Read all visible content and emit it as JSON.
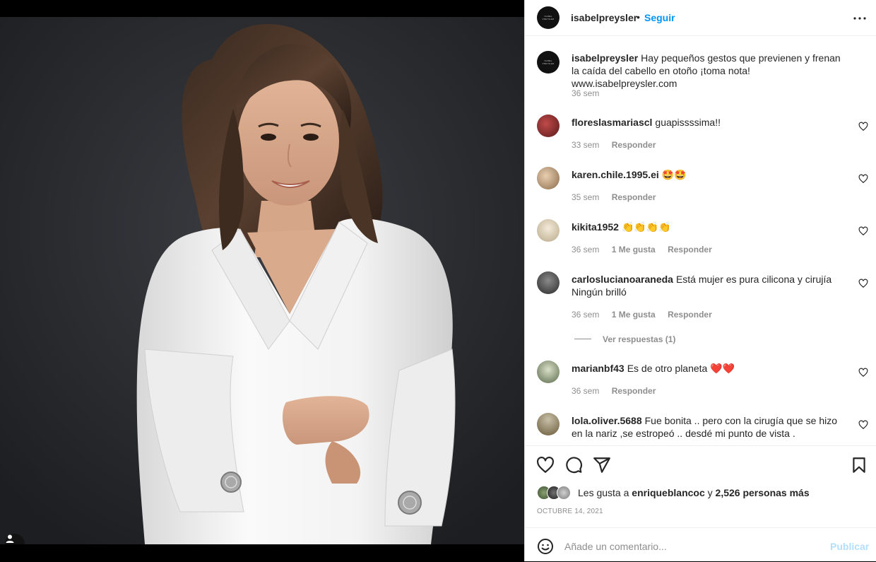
{
  "post": {
    "author": "isabelpreysler",
    "follow_label": "Seguir",
    "dot": "•",
    "caption": "Hay pequeños gestos que previenen y frenan la caída del cabello en otoño ¡toma nota! www.isabelpreysler.com",
    "caption_time": "36 sem",
    "logo_text": "ISABEL PREYSLER"
  },
  "comments": [
    {
      "user": "floreslasmariascl",
      "text": "guapissssima!!",
      "time": "33 sem",
      "likes": "",
      "reply": "Responder",
      "avatar_color": "#7a2a2a"
    },
    {
      "user": "karen.chile.1995.ei",
      "text": "🤩🤩",
      "time": "35 sem",
      "likes": "",
      "reply": "Responder",
      "avatar_color": "#c9a87f"
    },
    {
      "user": "kikita1952",
      "text": "👏👏👏👏",
      "time": "36 sem",
      "likes": "1 Me gusta",
      "reply": "Responder",
      "avatar_color": "#d8c9a8"
    },
    {
      "user": "carloslucianoaraneda",
      "text": "Está mujer es pura cilicona y cirujía Ningún brilló",
      "time": "36 sem",
      "likes": "1 Me gusta",
      "reply": "Responder",
      "avatar_color": "#4a4a4a",
      "view_replies": "Ver respuestas (1)"
    },
    {
      "user": "marianbf43",
      "text": "Es de otro planeta ❤️❤️",
      "time": "36 sem",
      "likes": "",
      "reply": "Responder",
      "avatar_color": "#8a9a7a"
    },
    {
      "user": "lola.oliver.5688",
      "text": "Fue bonita .. pero con la cirugía que se hizo en la nariz ,se estropeó .. desdé mi punto de vista .",
      "time": "",
      "likes": "",
      "reply": "",
      "avatar_color": "#9a8a6a"
    }
  ],
  "likes": {
    "prefix": "Les gusta a",
    "user": "enriqueblancoc",
    "conj": "y",
    "count": "2,526 personas más"
  },
  "date": "OCTUBRE 14, 2021",
  "composer": {
    "placeholder": "Añade un comentario...",
    "post_label": "Publicar"
  },
  "icons": {
    "more": "more-horizontal-icon",
    "like": "heart-icon",
    "comment": "comment-icon",
    "share": "paper-plane-icon",
    "save": "bookmark-icon",
    "emoji": "smiley-icon",
    "tag": "user-tag-icon"
  }
}
